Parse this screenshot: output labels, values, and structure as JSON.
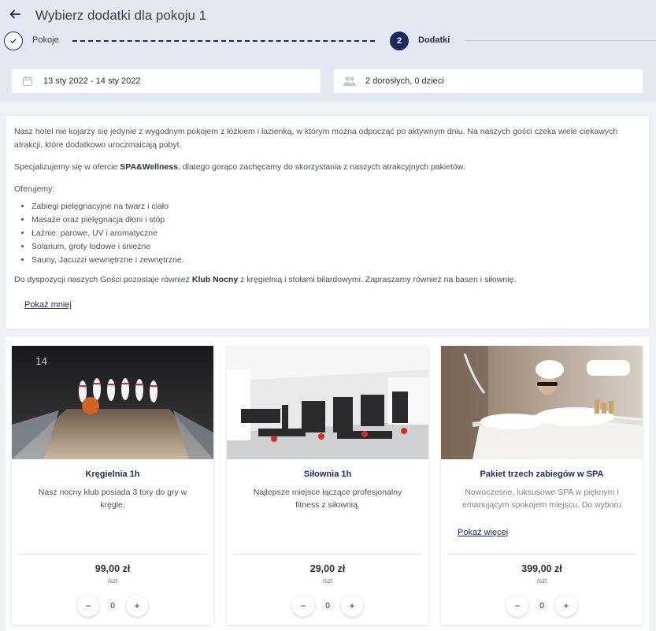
{
  "header": {
    "title": "Wybierz dodatki dla pokoju 1",
    "back_icon": "arrow-left-icon"
  },
  "steps": [
    {
      "label": "Pokoje",
      "state": "done",
      "icon": "check-icon"
    },
    {
      "label": "Dodatki",
      "number": "2",
      "state": "active"
    }
  ],
  "search": {
    "dates": "13 sty 2022 - 14 sty 2022",
    "dates_icon": "calendar-icon",
    "guests": "2 dorosłych, 0 dzieci",
    "guests_icon": "users-icon"
  },
  "description": {
    "p1": "Nasz hotel nie kojarzy się jedynie z wygodnym pokojem z łóżkiem i łazienką, w którym można odpocząć po aktywnym dniu. Na naszych gości czeka wiele ciekawych atrakcji, które dodatkowo uroczmaicają pobyt.",
    "p2_pre": "Specjalizujemy się w ofercie ",
    "p2_bold": "SPA&Wellness",
    "p2_post": ", dlatego gorąco zachęcamy do skorzystania z naszych atrakcyjnych pakietów.",
    "p3": "Oferujemy:",
    "list": [
      "Zabiegi pielęgnacyjne na twarz i ciało",
      "Masaże oraz pielęgnacja dłoni i stóp",
      "Łaźnie: parowe, UV i aromatyczne",
      "Solarium, groty lodowe i śnieżne",
      "Sauny, Jacuzzi wewnętrzne i zewnętrzne."
    ],
    "p4_pre": "Do dyspozycji naszych Gości pozostaje również ",
    "p4_bold": "Klub Nocny",
    "p4_post": " z kręgielnią i stołami bilardowymi. Zapraszamy również na basen i siłownię.",
    "show_less": "Pokaż mniej"
  },
  "offers": [
    {
      "title": "Kręgielnia 1h",
      "description": "Nasz nocny klub posiada 3 tory do gry w kręgle.",
      "price": "99,00 zł",
      "unit": "/szt",
      "quantity": "0"
    },
    {
      "title": "Siłownia 1h",
      "description": "Najlepsze miejsce łączące profesjonalny fitness z siłownią.",
      "price": "29,00 zł",
      "unit": "/szt",
      "quantity": "0"
    },
    {
      "title": "Pakiet trzech zabiegów w SPA",
      "description": "Nowoczesne, luksusowe SPA w pięknym i emanującym spokojem miejscu. Do wyboru",
      "more": "Pokaż więcej",
      "price": "399,00 zł",
      "unit": "/szt",
      "quantity": "0"
    }
  ],
  "qty_controls": {
    "minus": "−",
    "plus": "+"
  },
  "colors": {
    "accent": "#1e2a5e",
    "background": "#eef1f6"
  }
}
